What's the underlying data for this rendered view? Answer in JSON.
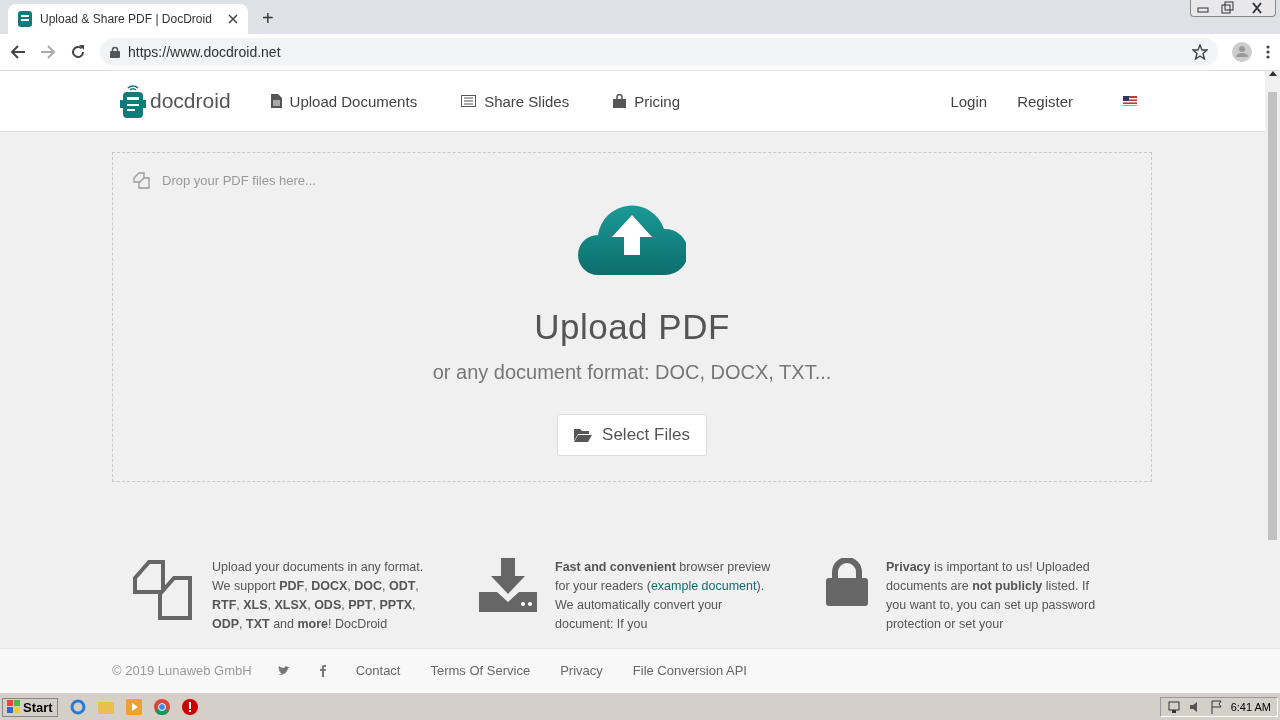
{
  "browser": {
    "tab_title": "Upload & Share PDF | DocDroid",
    "new_tab": "+",
    "url": "https://www.docdroid.net"
  },
  "nav": {
    "logo": "docdroid",
    "links": [
      {
        "kind": "file",
        "label": "Upload Documents"
      },
      {
        "kind": "slides",
        "label": "Share Slides"
      },
      {
        "kind": "bag",
        "label": "Pricing"
      }
    ],
    "login": "Login",
    "register": "Register"
  },
  "upload": {
    "drop_hint": "Drop your PDF files here...",
    "title": "Upload PDF",
    "subtitle": "or any document format: DOC, DOCX, TXT...",
    "button": "Select Files"
  },
  "features": [
    {
      "kind": "files",
      "text": "Upload your documents in any format. We support **PDF**, **DOCX**, **DOC**, **ODT**, **RTF**, **XLS**, **XLSX**, **ODS**, **PPT**, **PPTX**, **ODP**, **TXT** and **more**! DocDroid"
    },
    {
      "kind": "download",
      "text": "**Fast and convenient** browser preview for your readers (",
      "link": "example document",
      "text_after": "). We automatically convert your document: If you"
    },
    {
      "kind": "lock",
      "text": "**Privacy** is important to us! Uploaded documents are **not publicly** listed. If you want to, you can set up password protection or set your"
    }
  ],
  "footer": {
    "copyright": "© 2019 Lunaweb GmbH",
    "links": [
      "Contact",
      "Terms Of Service",
      "Privacy",
      "File Conversion API"
    ]
  },
  "taskbar": {
    "start": "Start",
    "time": "6:41 AM"
  }
}
